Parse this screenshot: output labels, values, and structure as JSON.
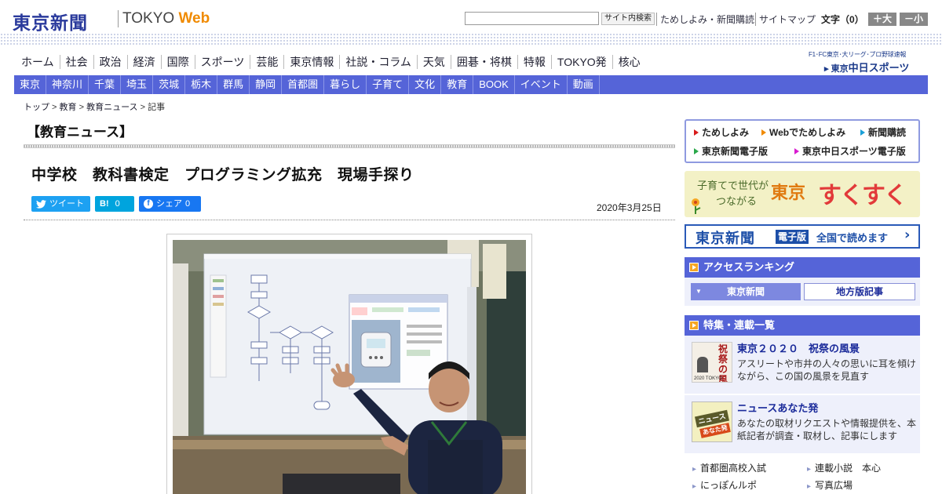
{
  "header": {
    "logo_main": "東京新聞",
    "logo_tokyo": "TOKYO",
    "logo_web": "Web",
    "search_button": "サイト内検索",
    "links": [
      "ためしよみ・新聞購読",
      "サイトマップ"
    ],
    "font_size_label": "文字（0）",
    "font_plus": "＋大",
    "font_minus": "－小"
  },
  "main_nav": [
    "ホーム",
    "社会",
    "政治",
    "経済",
    "国際",
    "スポーツ",
    "芸能",
    "東京情報",
    "社説・コラム",
    "天気",
    "囲碁・将棋",
    "特報",
    "TOKYO発",
    "核心"
  ],
  "sponsor": {
    "top": "F1･FC東京･大リーグ･プロ野球速報",
    "prefix": "東京",
    "name": "中日スポーツ"
  },
  "region_nav": [
    "東京",
    "神奈川",
    "千葉",
    "埼玉",
    "茨城",
    "栃木",
    "群馬",
    "静岡",
    "首都圏",
    "暮らし",
    "子育て",
    "文化",
    "教育",
    "BOOK",
    "イベント",
    "動画"
  ],
  "breadcrumb": {
    "items": [
      "トップ",
      "教育",
      "教育ニュース"
    ],
    "current": "記事",
    "sep": " > "
  },
  "article": {
    "section": "【教育ニュース】",
    "title": "中学校　教科書検定　プログラミング拡充　現場手探り",
    "date": "2020年3月25日",
    "share": {
      "tweet": "ツイート",
      "hatena": "B!",
      "hatena_count": "0",
      "fb": "シェア",
      "fb_count": "0"
    }
  },
  "sidebar": {
    "promo": [
      "ためしよみ",
      "Webでためしよみ",
      "新聞購読",
      "東京新聞電子版",
      "東京中日スポーツ電子版"
    ],
    "promo_colors": [
      "#d81b1b",
      "#f08a00",
      "#1aa0d8",
      "#2aa84a",
      "#d81bd0"
    ],
    "sukusuku_line1": "子育てで世代が",
    "sukusuku_line2": "つながる",
    "sukusuku_tokyo": "東京",
    "sukusuku_main": "すくすく",
    "ebanner_logo": "東京新聞",
    "ebanner_tag": "電子版",
    "ebanner_text": "全国で読めます",
    "ranking_title": "アクセスランキング",
    "ranking_tabs": [
      "東京新聞",
      "地方版記事"
    ],
    "features_title": "特集・連載一覧",
    "features": [
      {
        "title": "東京２０２０　祝祭の風景",
        "desc": "アスリートや市井の人々の思いに耳を傾けながら、この国の風景を見直す",
        "thumb_main": "祝祭の風景",
        "thumb_sub": "2020 TOKYO"
      },
      {
        "title": "ニュースあなた発",
        "desc": "あなたの取材リクエストや情報提供を、本紙記者が調査・取材し、記事にします",
        "thumb_main": "ニュース",
        "thumb_sub": "あなた発"
      }
    ],
    "more_links": [
      "首都圏高校入試",
      "連載小説　本心",
      "にっぽんルポ",
      "写真広場"
    ]
  }
}
